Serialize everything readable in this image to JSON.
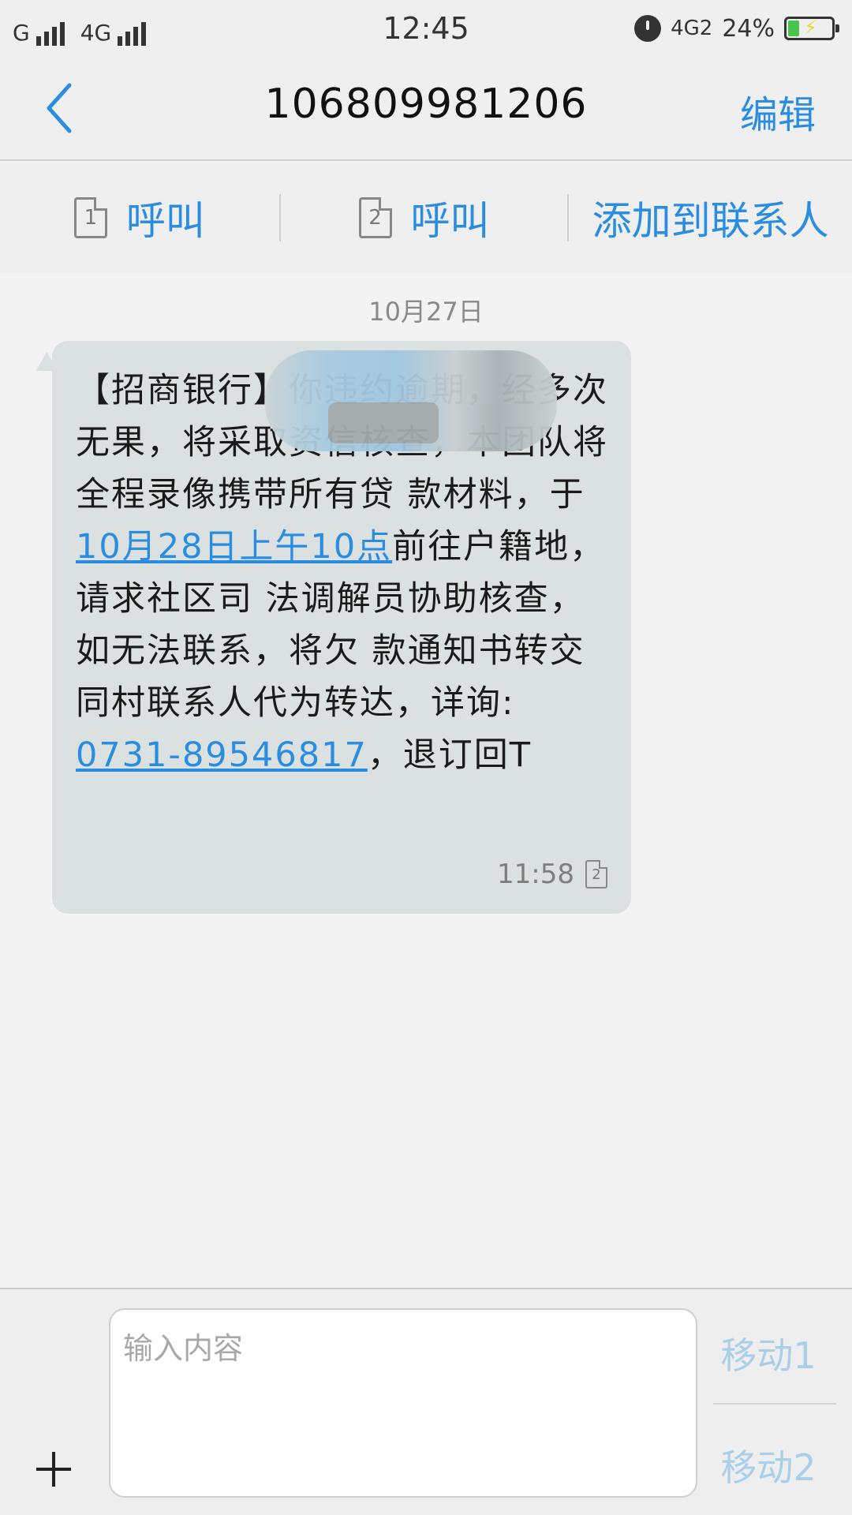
{
  "status_bar": {
    "carrier1": "G",
    "carrier2": "4G",
    "time": "12:45",
    "network": "4G2",
    "battery": "24%",
    "battery_level": 0.24
  },
  "header": {
    "title": "106809981206",
    "edit_label": "编辑"
  },
  "actions": {
    "call1_sim": "1",
    "call1_label": "呼叫",
    "call2_sim": "2",
    "call2_label": "呼叫",
    "add_contact_label": "添加到联系人"
  },
  "conversation": {
    "date": "10月27日",
    "message": {
      "text_1": "【招商银行】",
      "text_2": "你违约逾期，经多次",
      "text_3": "无果，将采取资信核查，本团队将全程录像携带所有贷 款材料，于",
      "link_date": "10月28日上午10点",
      "text_4": "前往户籍地，请求社区司 法调解员协助核查，如无法联系，将欠 款通知书转交同村联系人代为转达，详询: ",
      "link_phone": "0731-89546817",
      "text_5": "，退订回T",
      "time": "11:58",
      "sim": "2"
    }
  },
  "composer": {
    "placeholder": "输入内容",
    "send1_label": "移动1",
    "send2_label": "移动2"
  },
  "colors": {
    "accent": "#2a8de0",
    "bubble": "#dbe1e1",
    "send_disabled": "#a9cfe9"
  }
}
